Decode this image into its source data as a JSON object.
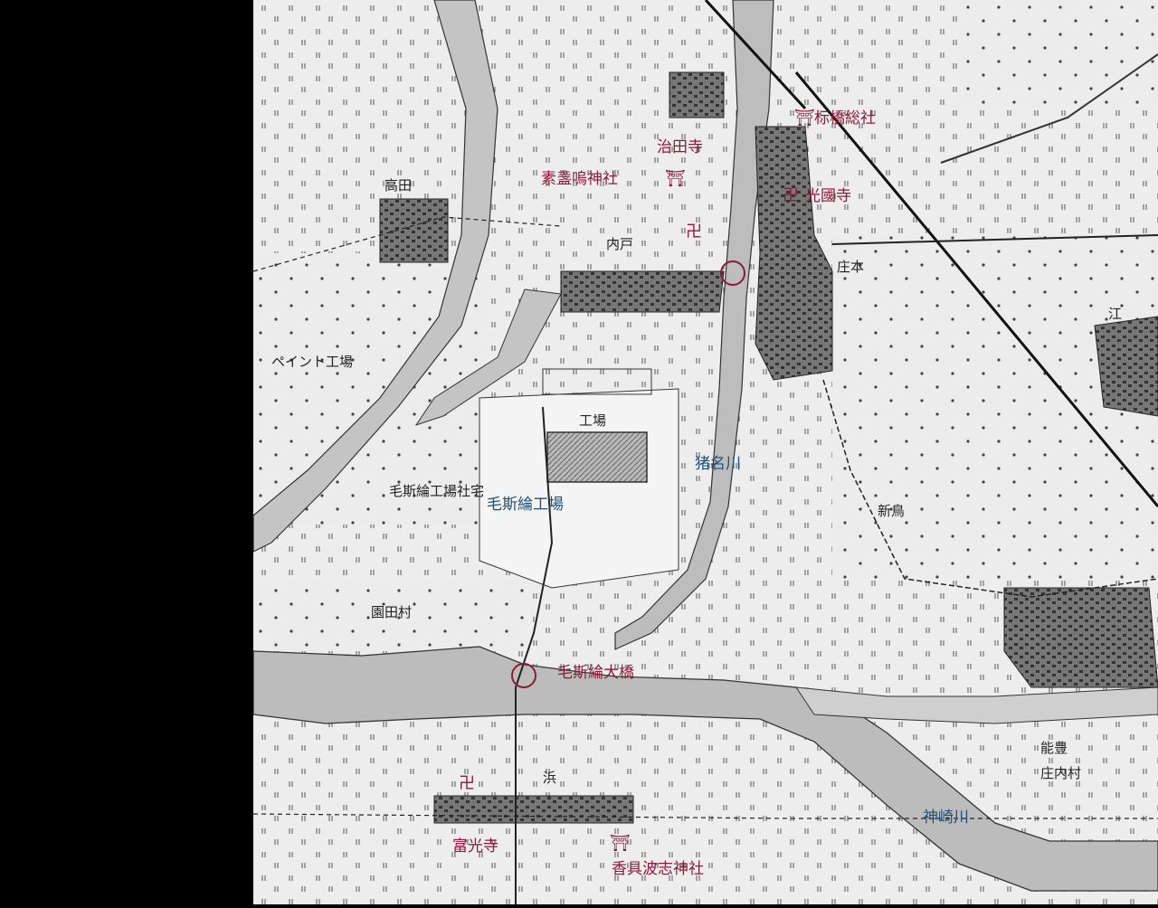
{
  "map": {
    "labels": {
      "soja": "标橋総社",
      "jiden_ji": "治田寺",
      "susanoo": "素盞嗚神社",
      "kokoku_ji": "光國寺",
      "inagawa": "猪名川",
      "mosulin_factory": "毛斯綸工場",
      "mosulin_bridge": "毛斯綸大橋",
      "kanzaki": "神崎川",
      "fuko_ji": "富光寺",
      "kagu_hashi": "香具波志神社"
    },
    "old_labels": {
      "taka_da": "高田",
      "uchi_to": "内戸",
      "sho_moto": "庄本",
      "paint": "ペイント工場",
      "sono_da": "園田村",
      "factory_house": "毛斯綸工場社宅",
      "factory_mark": "工場",
      "hama": "浜",
      "nose": "能豊",
      "shonai": "庄内村",
      "e": "江",
      "shinjima": "新鳥"
    },
    "symbols": {
      "shrine": "⛩",
      "temple": "卍"
    },
    "colors": {
      "label_red": "#8b1a3a",
      "label_blue": "#1f4e78",
      "paper": "#ececec",
      "river": "#bdbdbd",
      "ink": "#2a2a2a"
    }
  }
}
